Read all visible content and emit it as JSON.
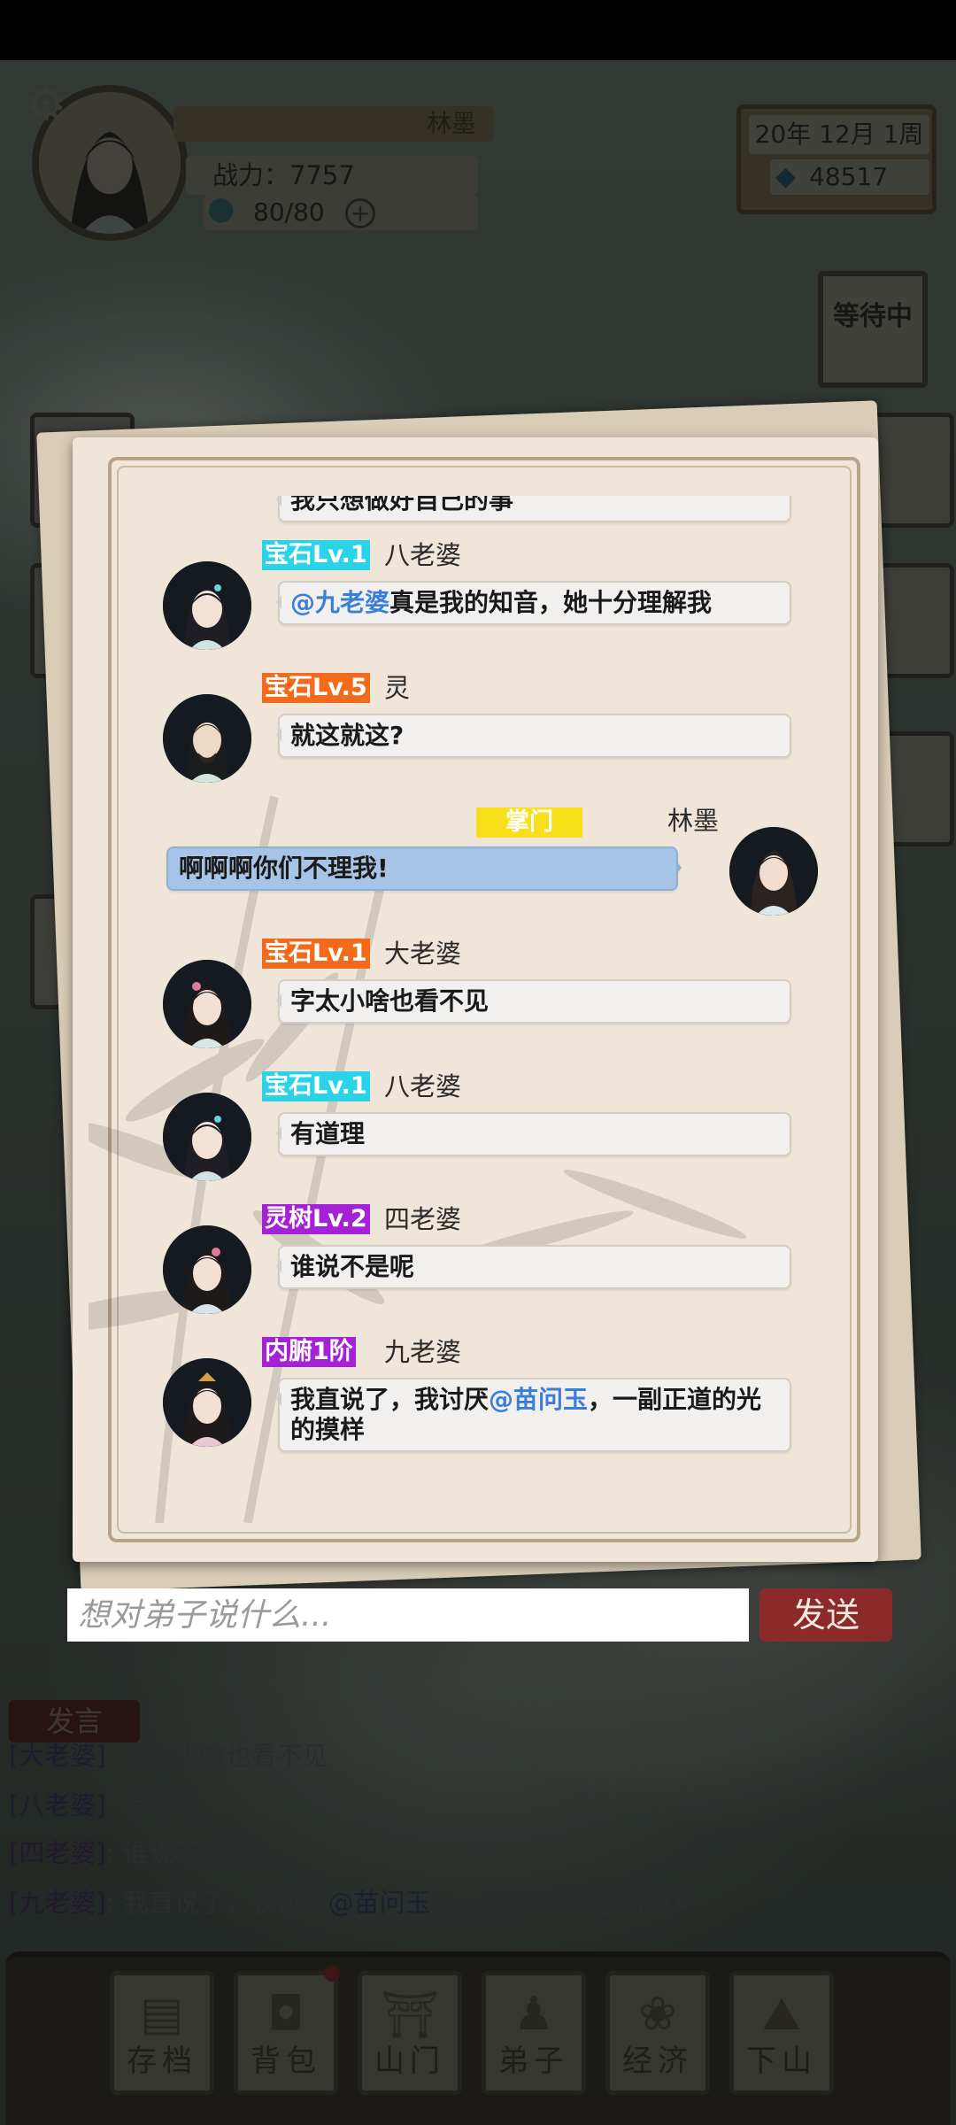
{
  "hud": {
    "player_name": "林墨",
    "power": "战力：7757",
    "stamina": "80/80",
    "date": "20年 12月 1周",
    "spirit_stones": "48517",
    "waiting_label": "等待中"
  },
  "chat": {
    "partial_top_text": "我只想做好自己的事",
    "messages": [
      {
        "badge": "宝石Lv.1",
        "badge_color": "cyan",
        "name": "八老婆",
        "at": "@九老婆",
        "text": "真是我的知音，她十分理解我"
      },
      {
        "badge": "宝石Lv.5",
        "badge_color": "orange",
        "name": "灵",
        "text": "就这就这?"
      },
      {
        "badge": "掌门",
        "badge_color": "gold",
        "name": "林墨",
        "text": "啊啊啊你们不理我!",
        "mine": true
      },
      {
        "badge": "宝石Lv.1",
        "badge_color": "orange",
        "name": "大老婆",
        "text": "字太小啥也看不见"
      },
      {
        "badge": "宝石Lv.1",
        "badge_color": "cyan",
        "name": "八老婆",
        "text": "有道理"
      },
      {
        "badge": "灵树Lv.2",
        "badge_color": "purple",
        "name": "四老婆",
        "text": "谁说不是呢"
      },
      {
        "badge": "内腑1阶",
        "badge_color": "purple",
        "name": "九老婆",
        "text_before": "我直说了，我讨厌",
        "at": "@苗问玉",
        "text_after": "，一副正道的光的摸样"
      }
    ]
  },
  "input": {
    "placeholder": "想对弟子说什么...",
    "send_label": "发送"
  },
  "log": {
    "speak_label": "发言",
    "lines": [
      {
        "name": "[大老婆]",
        "text": "字太小啥也看不见"
      },
      {
        "name": "[八老婆]",
        "text": "有道理"
      },
      {
        "name": "[四老婆]",
        "text": "谁说不是呢"
      },
      {
        "name": "[九老婆]",
        "text_before": "我直说了，我讨厌",
        "at": "@苗问玉",
        "text_after": "，一副正道的光的摸样"
      }
    ]
  },
  "bottom_nav": [
    "存档",
    "背包",
    "山门",
    "弟子",
    "经济",
    "下山"
  ],
  "colors": {
    "cyan_badge": "#2ad3e6",
    "orange_badge": "#f26a1a",
    "purple_badge": "#a421d6",
    "gold_badge": "#f7e01a",
    "send_button": "#8a2a2a",
    "mention": "#3a7ed8"
  }
}
